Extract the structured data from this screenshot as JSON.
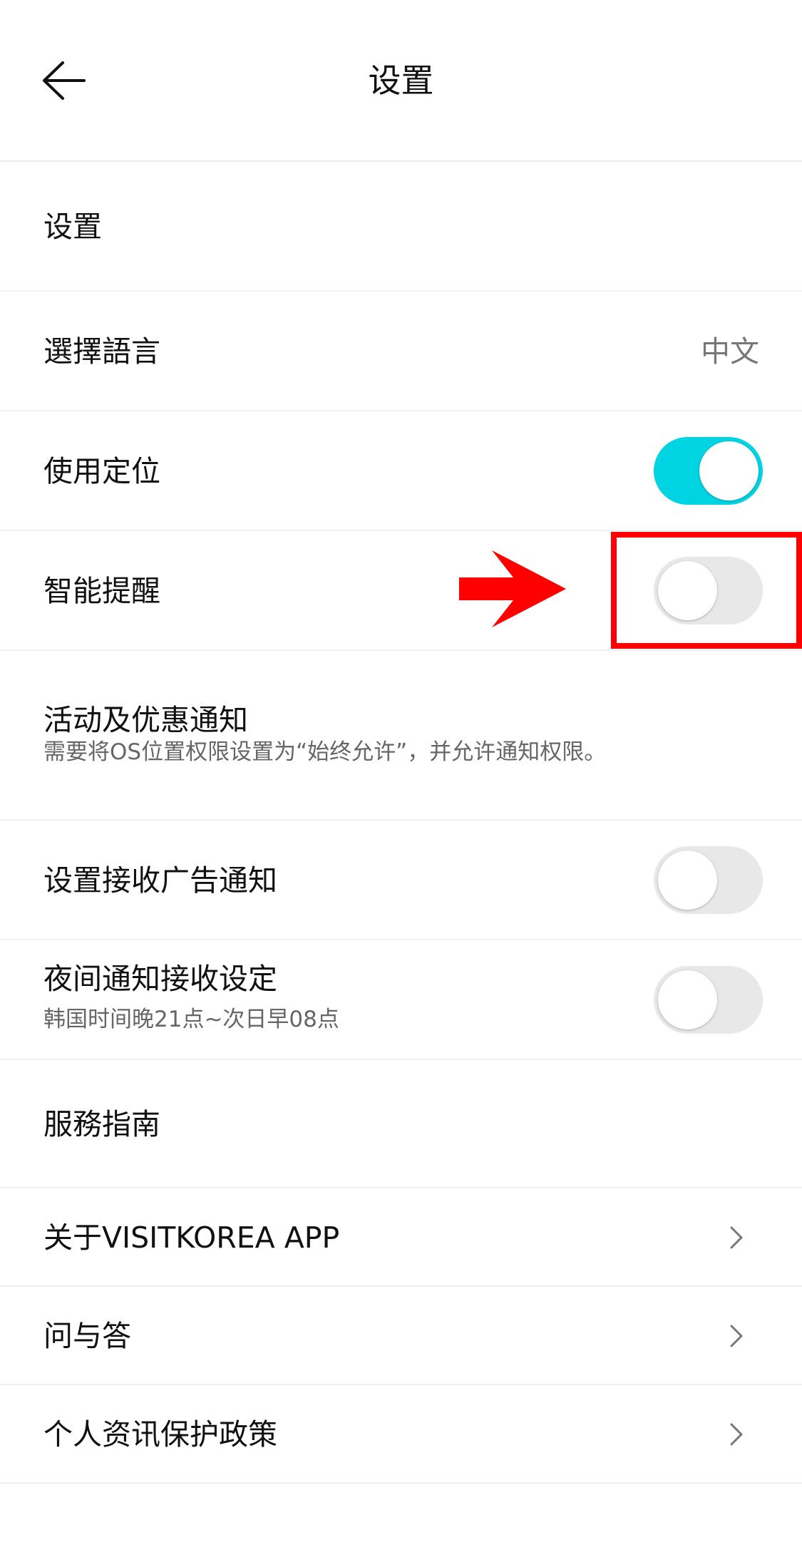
{
  "header": {
    "title": "设置"
  },
  "rows": {
    "settings_header": {
      "label": "设置"
    },
    "language": {
      "label": "選擇語言",
      "value": "中文"
    },
    "location": {
      "label": "使用定位",
      "toggle": "on"
    },
    "smart_reminder": {
      "label": "智能提醒",
      "toggle": "off"
    },
    "event_notice": {
      "label": "活动及优惠通知",
      "sub": "需要将OS位置权限设置为“始终允许”，并允许通知权限。"
    },
    "ad_notice": {
      "label": "设置接收广告通知",
      "toggle": "off"
    },
    "night_notice": {
      "label": "夜间通知接收设定",
      "sub": "韩国时间晚21点~次日早08点",
      "toggle": "off"
    },
    "service_guide": {
      "label": "服務指南"
    },
    "about": {
      "label": "关于VISITKOREA APP"
    },
    "qa": {
      "label": "问与答"
    },
    "privacy": {
      "label": "个人资讯保护政策"
    }
  },
  "colors": {
    "toggle_on": "#00d3e1",
    "toggle_off": "#e8e8e8",
    "annotation": "#ff0000"
  },
  "icons": {
    "back": "arrow-left-icon",
    "chevron": "chevron-right-icon"
  }
}
